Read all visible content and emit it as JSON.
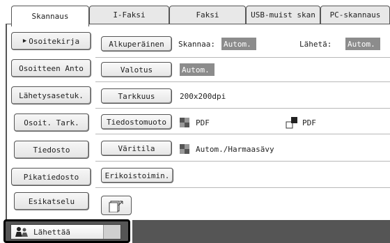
{
  "tabs": [
    "Skannaus",
    "I-Faksi",
    "Faksi",
    "USB-muist skan",
    "PC-skannaus"
  ],
  "nav": {
    "address_book": "Osoitekirja",
    "address_input": "Osoitteen Anto",
    "send_settings": "Lähetysasetuk.",
    "address_check": "Osoit. Tark.",
    "file": "Tiedosto",
    "quick_file": "Pikatiedosto",
    "preview": "Esikatselu"
  },
  "options": {
    "original_label": "Alkuperäinen",
    "scan_label": "Skannaa:",
    "scan_value": "Autom.",
    "send_label": "Lähetä:",
    "send_value": "Autom.",
    "exposure_label": "Valotus",
    "exposure_value": "Autom.",
    "resolution_label": "Tarkkuus",
    "resolution_value": "200x200dpi",
    "file_format_label": "Tiedostomuoto",
    "format_color_value": "PDF",
    "format_mono_value": "PDF",
    "color_mode_label": "Väritila",
    "color_mode_value": "Autom./Harmaasävy",
    "special_modes_label": "Erikoistoimin."
  },
  "footer": {
    "send_label": "Lähettää"
  },
  "colors": {
    "auto_box": "#8c8c8c",
    "bottom_bar": "#555555"
  }
}
